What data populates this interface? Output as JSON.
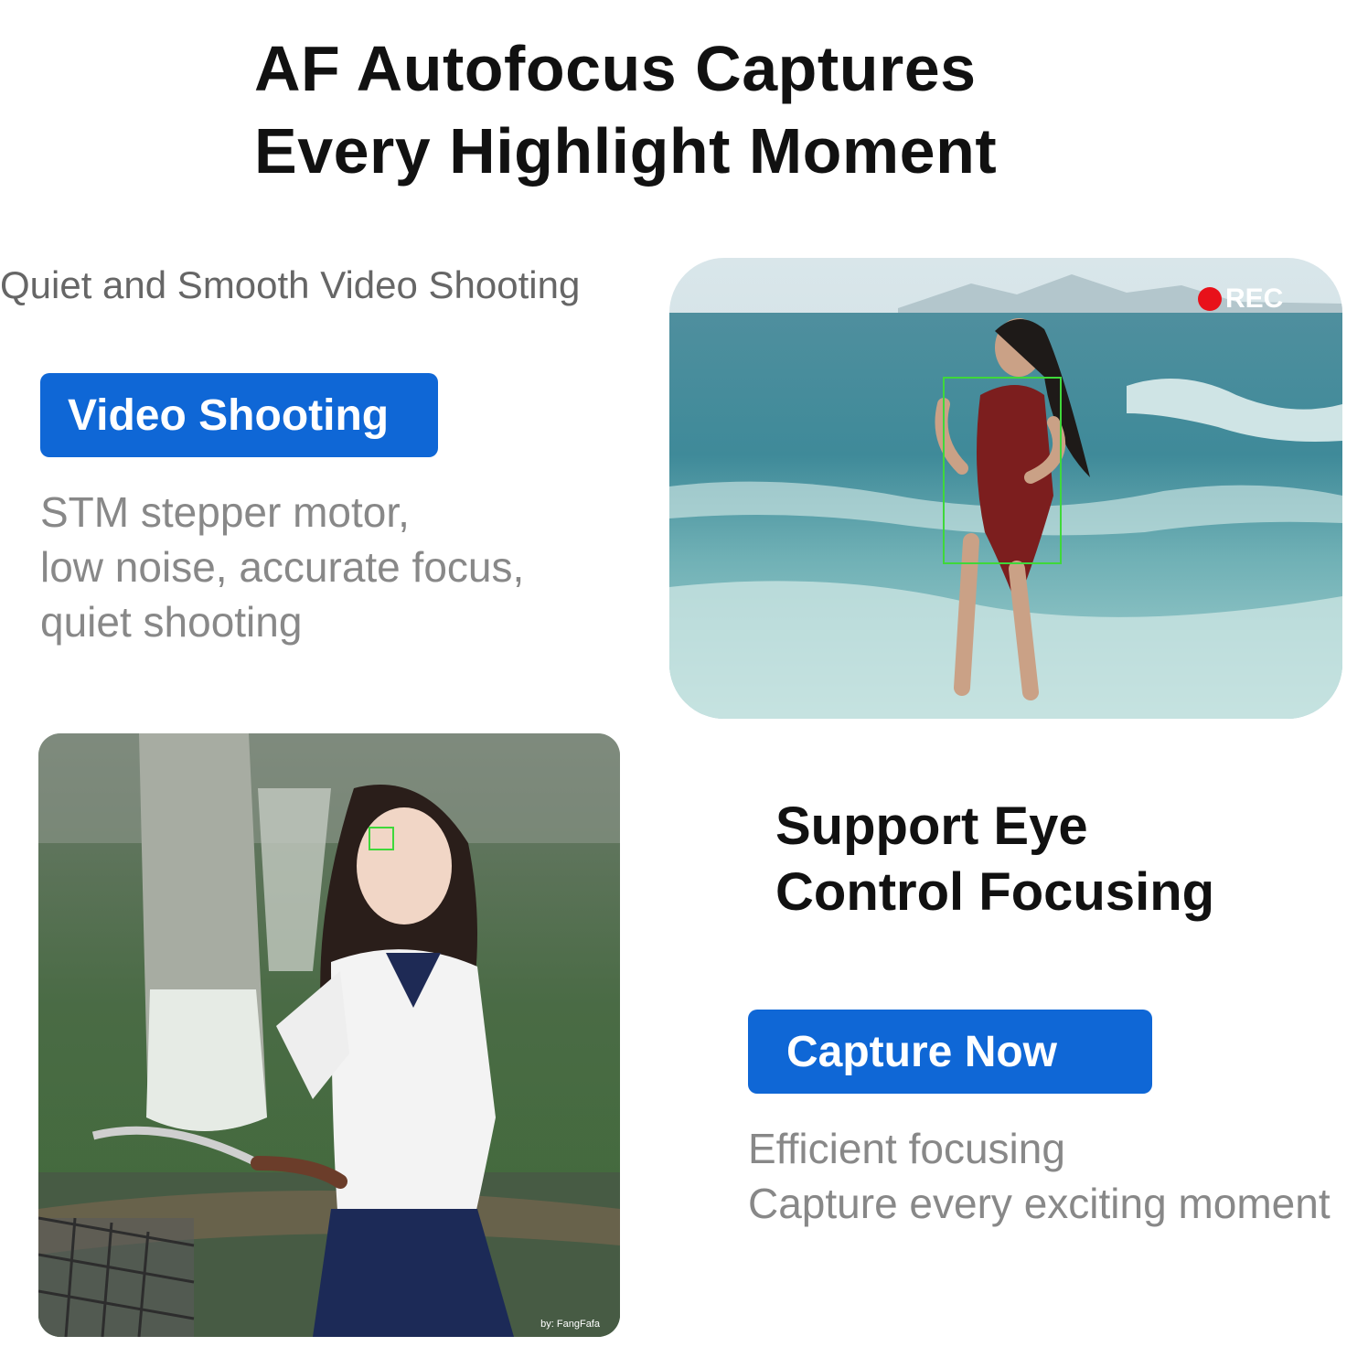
{
  "header": {
    "line1": "AF Autofocus Captures",
    "line2": "Every Highlight Moment"
  },
  "video_section": {
    "subtitle": "Quiet and Smooth Video Shooting",
    "pill_label": "Video Shooting",
    "description": [
      "STM stepper motor,",
      "low noise, accurate focus,",
      "quiet shooting"
    ],
    "rec_label": "REC"
  },
  "eye_section": {
    "title": [
      "Support Eye",
      "Control Focusing"
    ],
    "pill_label": "Capture Now",
    "description": [
      "Efficient focusing",
      "Capture every exciting moment"
    ]
  },
  "photo_credit": "by: FangFafa",
  "colors": {
    "accent_blue": "#0f67d6",
    "focus_box_green": "#3fd83a",
    "rec_red": "#e8111a"
  }
}
